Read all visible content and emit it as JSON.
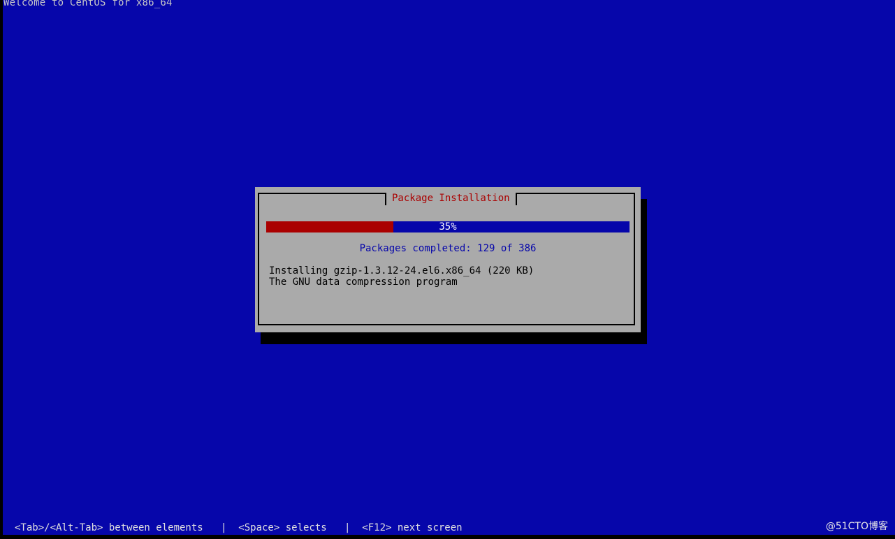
{
  "screen": {
    "title": "Welcome to CentOS for x86_64",
    "background_color": "#0606aa"
  },
  "dialog": {
    "title": "Package Installation",
    "progress": {
      "percent": 35,
      "label": "35%",
      "fill_color": "#aa0000",
      "track_color": "#0606aa"
    },
    "packages_completed": "Packages completed: 129 of 386",
    "install_line": "Installing gzip-1.3.12-24.el6.x86_64 (220 KB)",
    "description": "The GNU data compression program"
  },
  "help_line": "<Tab>/<Alt-Tab> between elements   |  <Space> selects   |  <F12> next screen",
  "watermark": "@51CTO博客"
}
